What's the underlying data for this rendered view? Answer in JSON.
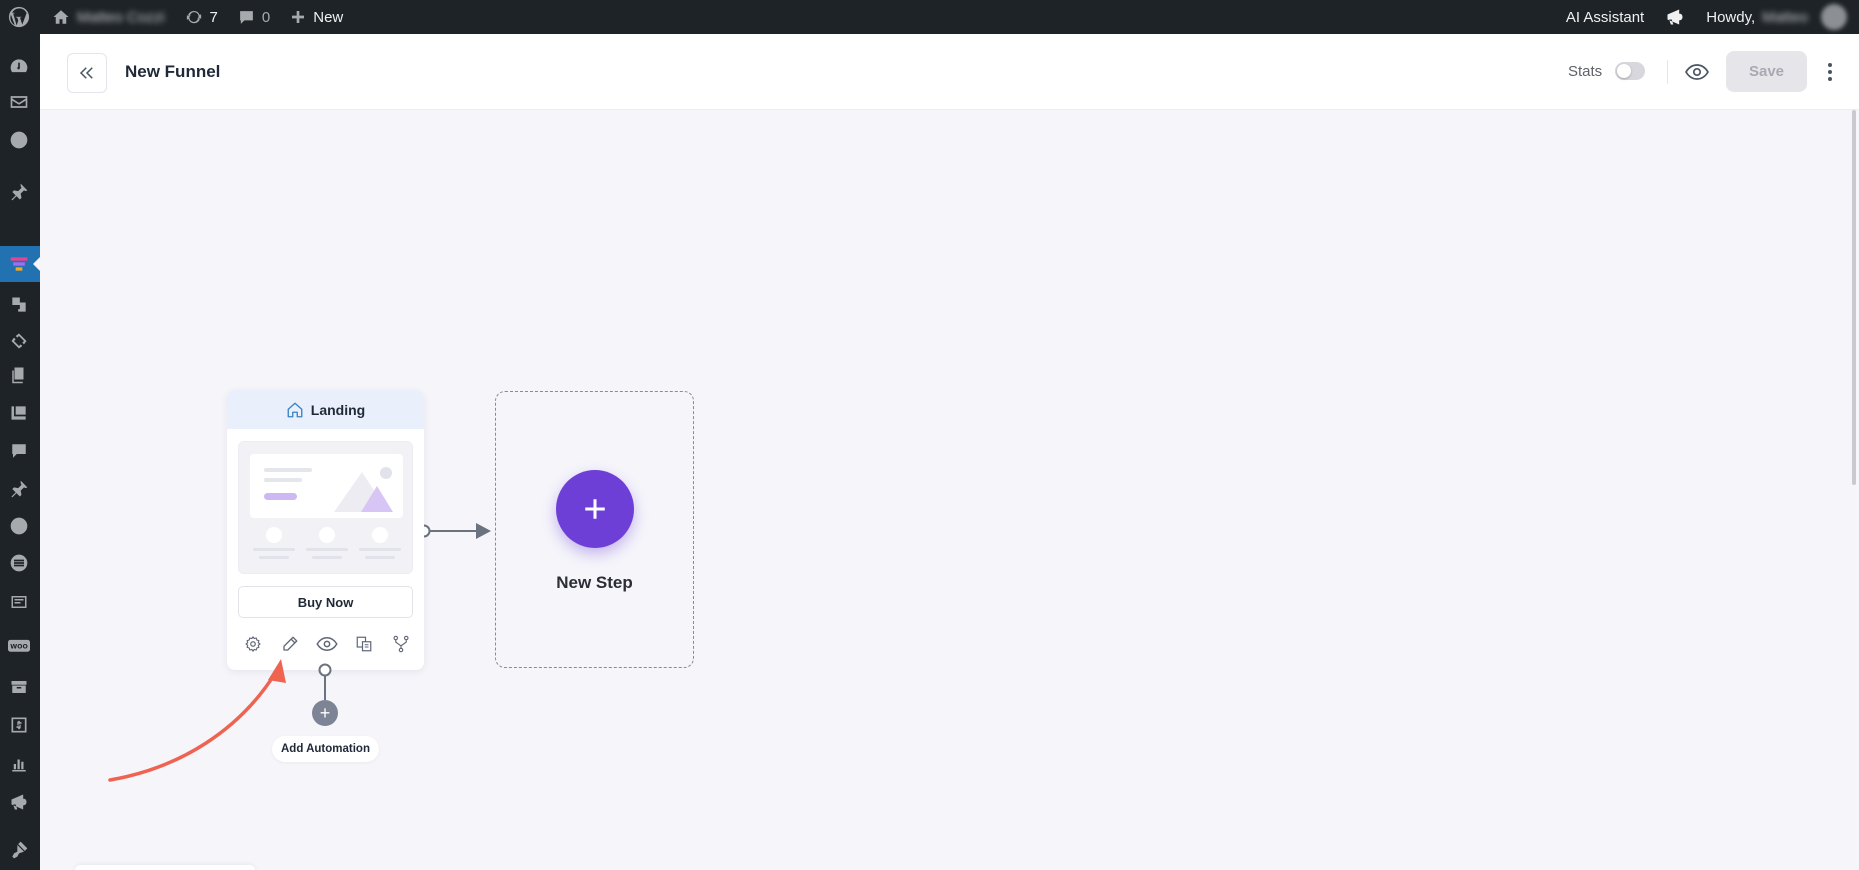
{
  "adminbar": {
    "site_name": "Matteo Cozzi",
    "updates_count": "7",
    "comments_count": "0",
    "new_label": "New",
    "ai_assistant": "AI Assistant",
    "howdy": "Howdy,",
    "user_name": "Matteo"
  },
  "header": {
    "title": "New Funnel",
    "stats_label": "Stats",
    "stats_enabled": false,
    "save_label": "Save",
    "save_disabled": true
  },
  "canvas": {
    "step_card": {
      "title": "Landing",
      "cta_label": "Buy Now",
      "actions": [
        "settings-icon",
        "edit-icon",
        "preview-icon",
        "duplicate-icon",
        "split-test-icon"
      ]
    },
    "new_step_label": "New Step",
    "add_automation_label": "Add Automation"
  },
  "colors": {
    "adminbar": "#1d2327",
    "accent": "#6d3fd6",
    "annotation_arrow": "#ef6351",
    "active_menu": "#2271b1"
  }
}
